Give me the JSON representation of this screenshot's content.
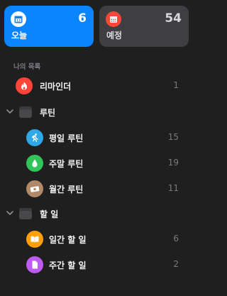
{
  "smart_lists": {
    "today": {
      "label": "오늘",
      "count": "6",
      "icon": "calendar-today-icon",
      "color": "#0a84ff"
    },
    "scheduled": {
      "label": "예정",
      "count": "54",
      "icon": "calendar-icon",
      "color": "#3f3f42"
    }
  },
  "my_lists": {
    "header": "나의 목록",
    "reminders": {
      "label": "리마인더",
      "count": "1",
      "icon": "flame-icon",
      "color": "#ff453a"
    },
    "groups": [
      {
        "label": "루틴",
        "icon": "folder-icon",
        "items": [
          {
            "label": "평일 루틴",
            "count": "15",
            "icon": "running-person-icon",
            "color": "#2ea8e6"
          },
          {
            "label": "주말 루틴",
            "count": "19",
            "icon": "drop-icon",
            "color": "#30c45a"
          },
          {
            "label": "월간 루틴",
            "count": "11",
            "icon": "money-icon",
            "color": "#b08a68"
          }
        ]
      },
      {
        "label": "할 일",
        "icon": "folder-icon",
        "items": [
          {
            "label": "일간 할 일",
            "count": "6",
            "icon": "book-icon",
            "color": "#ff9f0a"
          },
          {
            "label": "주간 할 일",
            "count": "2",
            "icon": "document-icon",
            "color": "#bf5af2"
          }
        ]
      }
    ]
  }
}
